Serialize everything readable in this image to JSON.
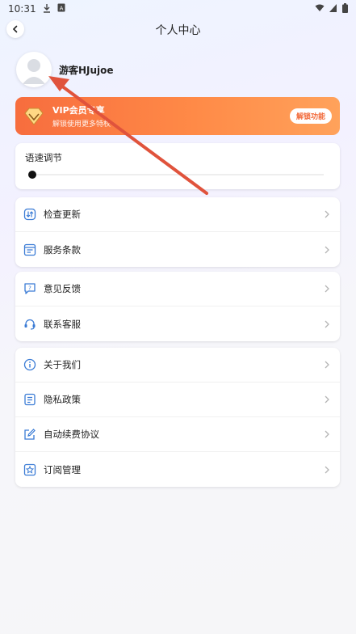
{
  "status_bar": {
    "time": "10:31",
    "icons": [
      "download-icon",
      "a-icon",
      "wifi-icon",
      "cellular-icon",
      "battery-icon"
    ]
  },
  "header": {
    "title": "个人中心",
    "back_icon": "chevron-left-icon"
  },
  "profile": {
    "username": "游客HJujoe",
    "avatar_icon": "default-avatar-icon"
  },
  "vip": {
    "title": "VIP会员专享",
    "subtitle": "解锁使用更多特权",
    "button_label": "解锁功能",
    "badge_icon": "diamond-icon",
    "colors": {
      "start": "#f76d3e",
      "end": "#ffa25b"
    }
  },
  "speed": {
    "label": "语速调节",
    "level": 0
  },
  "groups": [
    {
      "items": [
        {
          "label": "检查更新",
          "icon": "update-icon"
        },
        {
          "label": "服务条款",
          "icon": "terms-icon"
        }
      ]
    },
    {
      "items": [
        {
          "label": "意见反馈",
          "icon": "feedback-icon"
        },
        {
          "label": "联系客服",
          "icon": "headset-icon"
        }
      ]
    },
    {
      "items": [
        {
          "label": "关于我们",
          "icon": "info-icon"
        },
        {
          "label": "隐私政策",
          "icon": "privacy-icon"
        },
        {
          "label": "自动续费协议",
          "icon": "edit-icon"
        },
        {
          "label": "订阅管理",
          "icon": "subscription-icon"
        }
      ]
    }
  ],
  "accent_color": "#3a7bd5",
  "annotation_color": "#e0533c"
}
